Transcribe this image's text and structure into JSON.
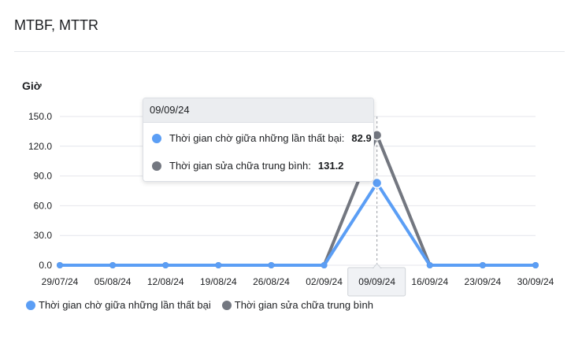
{
  "card": {
    "title": "MTBF, MTTR"
  },
  "chart_data": {
    "type": "line",
    "ylabel": "Giờ",
    "ylim": [
      0,
      150
    ],
    "yticks": [
      "0.0",
      "30.0",
      "60.0",
      "90.0",
      "120.0",
      "150.0"
    ],
    "ytick_values": [
      0,
      30,
      60,
      90,
      120,
      150
    ],
    "categories": [
      "29/07/24",
      "05/08/24",
      "12/08/24",
      "19/08/24",
      "26/08/24",
      "02/09/24",
      "09/09/24",
      "16/09/24",
      "23/09/24",
      "30/09/24"
    ],
    "series": [
      {
        "name": "Thời gian chờ giữa những lần thất bại",
        "color": "#5b9ef5",
        "values": [
          0,
          0,
          0,
          0,
          0,
          0,
          82.9,
          0,
          0,
          0
        ]
      },
      {
        "name": "Thời gian sửa chữa trung bình",
        "color": "#737780",
        "values": [
          0,
          0,
          0,
          0,
          0,
          0,
          131.2,
          0,
          0,
          0
        ]
      }
    ],
    "grid": true,
    "legend": "bottom-left",
    "highlighted_index": 6
  },
  "tooltip": {
    "title": "09/09/24",
    "rows": [
      {
        "label": "Thời gian chờ giữa những lần thất bại:",
        "value": "82.9",
        "color": "#5b9ef5"
      },
      {
        "label": "Thời gian sửa chữa trung bình:",
        "value": "131.2",
        "color": "#737780"
      }
    ]
  },
  "legend": {
    "items": [
      {
        "label": "Thời gian chờ giữa những lần thất bại",
        "color": "#5b9ef5",
        "icon": "circle-marker-icon"
      },
      {
        "label": "Thời gian sửa chữa trung bình",
        "color": "#737780",
        "icon": "circle-marker-icon"
      }
    ]
  }
}
